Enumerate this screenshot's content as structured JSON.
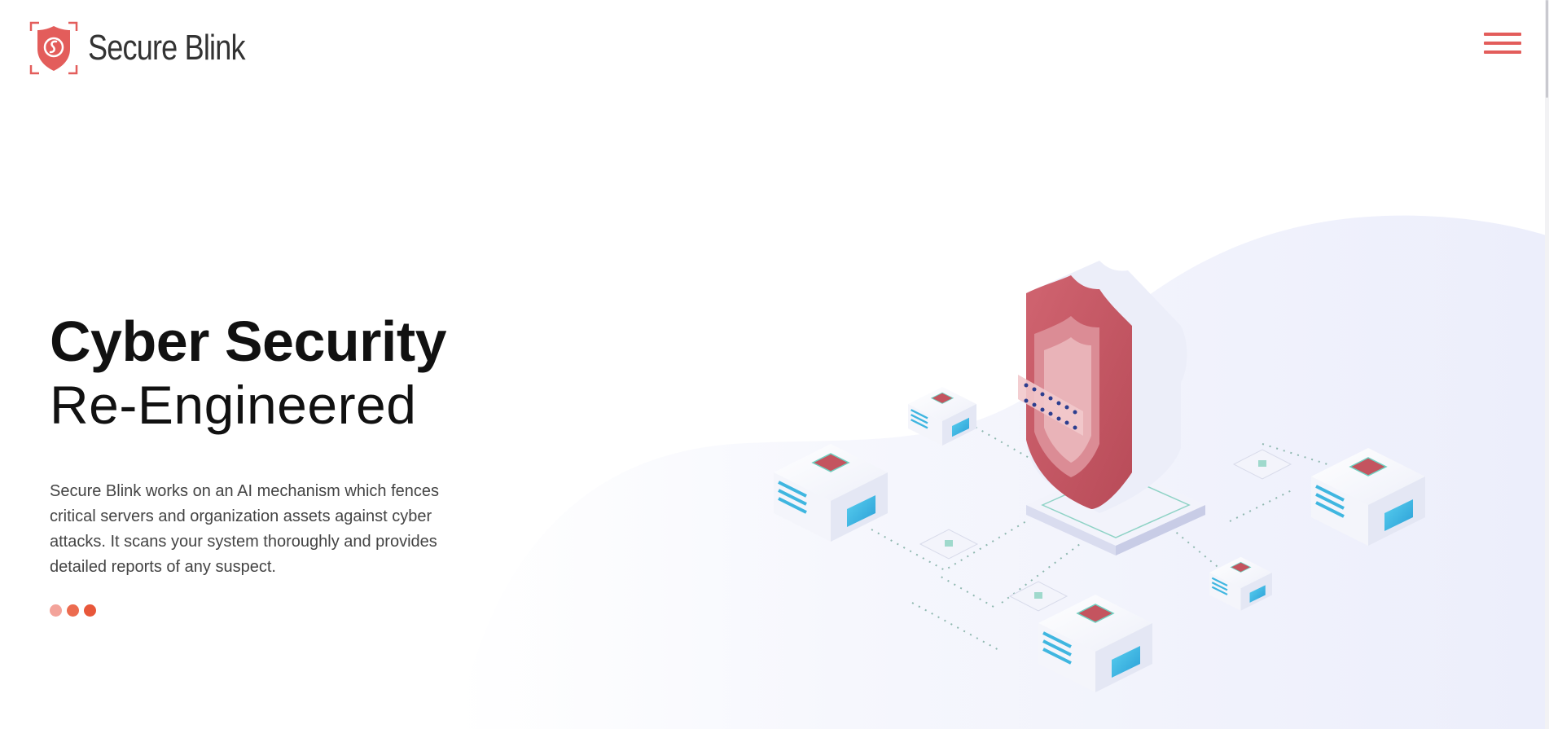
{
  "brand": {
    "name": "Secure Blink",
    "logo_icon": "shield-logo-icon",
    "accent_color": "#e35d5b"
  },
  "header": {
    "menu_icon": "hamburger-menu-icon"
  },
  "hero": {
    "title_line1": "Cyber Security",
    "title_line2": "Re-Engineered",
    "description": "Secure Blink works on an AI mechanism which fences critical servers and organization assets against cyber attacks. It scans your system thoroughly and provides detailed reports of any suspect."
  },
  "slider": {
    "dot_colors": [
      "#f3a39a",
      "#ec6b4f",
      "#e8573a"
    ]
  },
  "illustration": {
    "icon": "shield-network-illustration",
    "colors": {
      "shield_red": "#c4545f",
      "server_teal": "#3fb6e0",
      "background_blob": "#eef0fc"
    }
  }
}
